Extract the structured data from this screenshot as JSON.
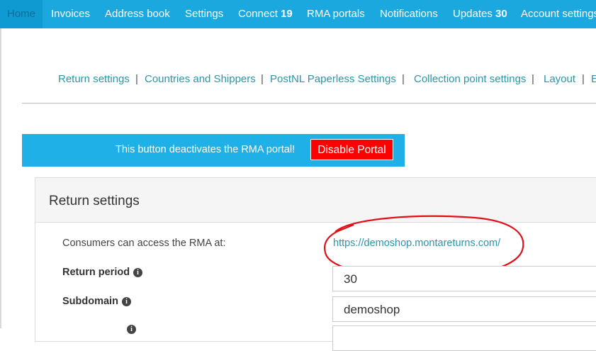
{
  "topnav": {
    "items": [
      {
        "label": "Home",
        "badge": ""
      },
      {
        "label": "Invoices",
        "badge": ""
      },
      {
        "label": "Address book",
        "badge": ""
      },
      {
        "label": "Settings",
        "badge": ""
      },
      {
        "label": "Connect",
        "badge": "19"
      },
      {
        "label": "RMA portals",
        "badge": ""
      },
      {
        "label": "Notifications",
        "badge": ""
      },
      {
        "label": "Updates",
        "badge": "30"
      },
      {
        "label": "Account settings",
        "badge": ""
      }
    ]
  },
  "subnav": {
    "items": [
      "Return settings",
      "Countries and Shippers",
      "PostNL Paperless Settings",
      "Collection point settings",
      "Layout",
      "E"
    ],
    "separator": "|"
  },
  "banner": {
    "text": "This button deactivates the RMA portal!",
    "button_label": "Disable Portal"
  },
  "panel": {
    "title": "Return settings",
    "access_label": "Consumers can access the RMA at:",
    "access_url": "https://demoshop.montareturns.com/",
    "return_period_label": "Return period",
    "return_period_value": "30",
    "subdomain_label": "Subdomain",
    "subdomain_value": "demoshop"
  },
  "colors": {
    "nav_bg": "#1aa8de",
    "banner_bg": "#1eb0e6",
    "danger": "#ff0000",
    "link": "#2a96a8",
    "annotation": "#e0101a"
  }
}
